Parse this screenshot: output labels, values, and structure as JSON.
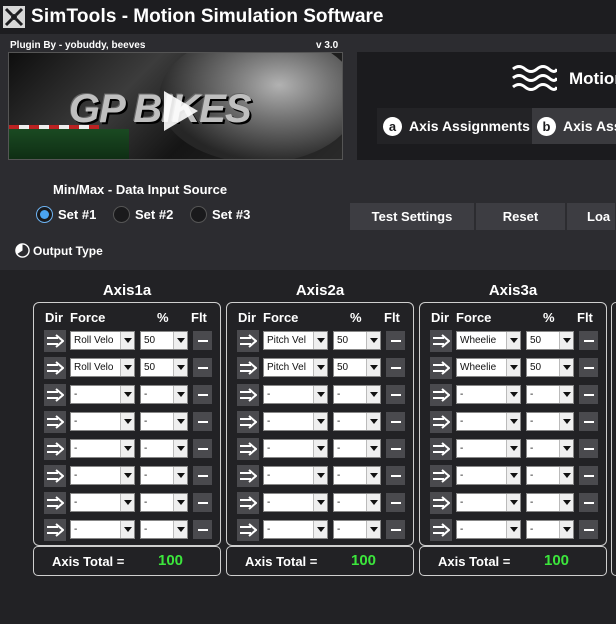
{
  "window": {
    "brand": "SimTools",
    "title_suffix": "- Motion Simulation Software"
  },
  "plugin": {
    "credit": "Plugin By - yobuddy, beeves",
    "version": "v 3.0",
    "banner_logo": "GP BIKES"
  },
  "right_panel": {
    "title": "Motion",
    "tabs": [
      {
        "badge": "a",
        "label": "Axis Assignments"
      },
      {
        "badge": "b",
        "label": "Axis Ass"
      }
    ]
  },
  "source": {
    "label": "Min/Max - Data Input Source",
    "options": [
      "Set #1",
      "Set #2",
      "Set #3"
    ],
    "selected": "Set #1"
  },
  "buttons": {
    "test_settings": "Test Settings",
    "reset": "Reset",
    "load": "Loa"
  },
  "output_type": "Output Type",
  "table_headers": {
    "dir": "Dir",
    "force": "Force",
    "percent": "%",
    "flt": "Flt"
  },
  "axis_total_label": "Axis Total =",
  "axes": [
    {
      "title": "Axis1a",
      "total": "100",
      "rows": [
        {
          "force": "Roll Velo",
          "percent": "50"
        },
        {
          "force": "Roll Velo",
          "percent": "50"
        },
        {
          "force": "-",
          "percent": "-"
        },
        {
          "force": "-",
          "percent": "-"
        },
        {
          "force": "-",
          "percent": "-"
        },
        {
          "force": "-",
          "percent": "-"
        },
        {
          "force": "-",
          "percent": "-"
        },
        {
          "force": "-",
          "percent": "-"
        }
      ]
    },
    {
      "title": "Axis2a",
      "total": "100",
      "rows": [
        {
          "force": "Pitch Vel",
          "percent": "50"
        },
        {
          "force": "Pitch Vel",
          "percent": "50"
        },
        {
          "force": "-",
          "percent": "-"
        },
        {
          "force": "-",
          "percent": "-"
        },
        {
          "force": "-",
          "percent": "-"
        },
        {
          "force": "-",
          "percent": "-"
        },
        {
          "force": "-",
          "percent": "-"
        },
        {
          "force": "-",
          "percent": "-"
        }
      ]
    },
    {
      "title": "Axis3a",
      "total": "100",
      "rows": [
        {
          "force": "Wheelie",
          "percent": "50"
        },
        {
          "force": "Wheelie",
          "percent": "50"
        },
        {
          "force": "-",
          "percent": "-"
        },
        {
          "force": "-",
          "percent": "-"
        },
        {
          "force": "-",
          "percent": "-"
        },
        {
          "force": "-",
          "percent": "-"
        },
        {
          "force": "-",
          "percent": "-"
        },
        {
          "force": "-",
          "percent": "-"
        }
      ]
    }
  ],
  "colors": {
    "accent_radio": "#4aa3f0",
    "total_value": "#3ce63c",
    "background": "#2c2c30"
  }
}
